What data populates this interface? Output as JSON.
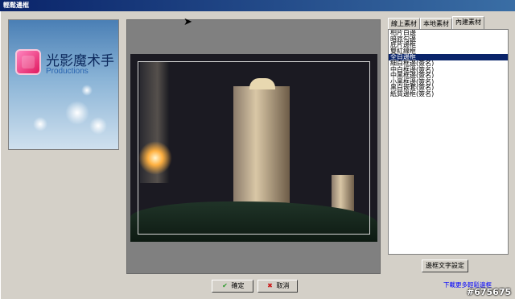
{
  "window": {
    "title": "輕鬆邊框"
  },
  "logo": {
    "title": "光影魔术手",
    "subtitle": "Productions"
  },
  "tabs": [
    {
      "label": "線上素材"
    },
    {
      "label": "本地素材"
    },
    {
      "label": "內建素材"
    }
  ],
  "active_tab": "內建素材",
  "frames": [
    "相片白邊",
    "暗底勾邊",
    "底片邊框",
    "雙紅線框",
    "全白邊框",
    "細白框邊(簽名)",
    "中白框邊(簽名)",
    "中黑框邊(簽名)",
    "小黑框邊(簽名)",
    "黑白嵌套(簽名)",
    "紙質邊框(簽名)"
  ],
  "selected_frame": "全白邊框",
  "buttons": {
    "text_settings": "邊框文字設定",
    "ok": "確定",
    "cancel": "取消"
  },
  "link": {
    "download_more": "下載更多輕鬆邊框"
  },
  "watermark": "#675675",
  "colors": {
    "titlebar": "#0a246a",
    "selection": "#0a246a",
    "link": "#0000ff"
  },
  "icons": {
    "ok": "checkmark-icon",
    "cancel": "x-icon"
  }
}
